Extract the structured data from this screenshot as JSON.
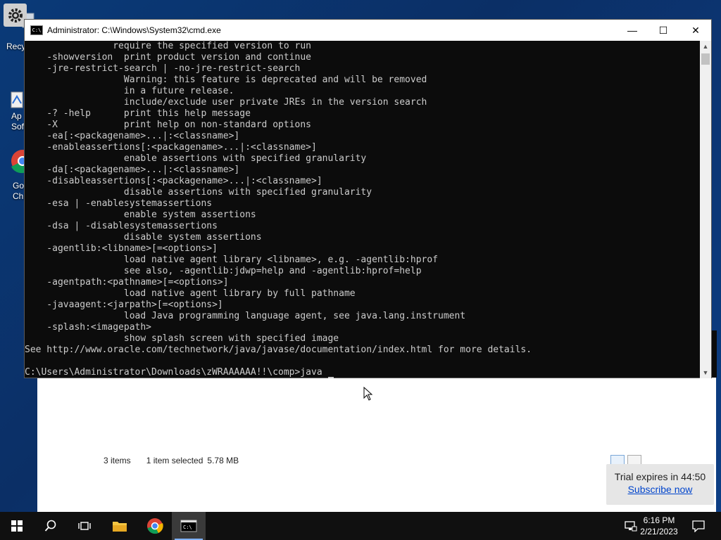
{
  "desktop": {
    "icons": [
      {
        "label": "Recy"
      },
      {
        "label": "Ap\nSof"
      },
      {
        "label": "Go\nChr"
      }
    ]
  },
  "cmd": {
    "title": "Administrator: C:\\Windows\\System32\\cmd.exe",
    "icon_text": "C:\\",
    "minimize": "—",
    "maximize": "☐",
    "close": "✕",
    "lines": [
      "                require the specified version to run",
      "    -showversion  print product version and continue",
      "    -jre-restrict-search | -no-jre-restrict-search",
      "                  Warning: this feature is deprecated and will be removed",
      "                  in a future release.",
      "                  include/exclude user private JREs in the version search",
      "    -? -help      print this help message",
      "    -X            print help on non-standard options",
      "    -ea[:<packagename>...|:<classname>]",
      "    -enableassertions[:<packagename>...|:<classname>]",
      "                  enable assertions with specified granularity",
      "    -da[:<packagename>...|:<classname>]",
      "    -disableassertions[:<packagename>...|:<classname>]",
      "                  disable assertions with specified granularity",
      "    -esa | -enablesystemassertions",
      "                  enable system assertions",
      "    -dsa | -disablesystemassertions",
      "                  disable system assertions",
      "    -agentlib:<libname>[=<options>]",
      "                  load native agent library <libname>, e.g. -agentlib:hprof",
      "                  see also, -agentlib:jdwp=help and -agentlib:hprof=help",
      "    -agentpath:<pathname>[=<options>]",
      "                  load native agent library by full pathname",
      "    -javaagent:<jarpath>[=<options>]",
      "                  load Java programming language agent, see java.lang.instrument",
      "    -splash:<imagepath>",
      "                  show splash screen with specified image",
      "See http://www.oracle.com/technetwork/java/javase/documentation/index.html for more details.",
      "",
      "C:\\Users\\Administrator\\Downloads\\zWRAAAAAA!!\\comp>java "
    ]
  },
  "explorer": {
    "items_count": "3 items",
    "selection": "1 item selected",
    "size": "5.78 MB"
  },
  "toast": {
    "message": "Trial expires in 44:50",
    "link": "Subscribe now"
  },
  "taskbar": {
    "time": "6:16 PM",
    "date": "2/21/2023"
  }
}
